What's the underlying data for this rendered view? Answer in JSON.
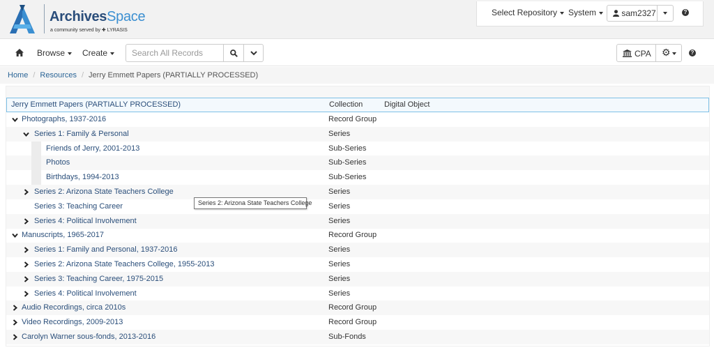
{
  "brand": {
    "name_part1": "Archives",
    "name_part2": "Space",
    "tagline": "a community served by ✚ LYRASIS"
  },
  "header_nav": {
    "select_repository": "Select Repository",
    "system": "System",
    "username": "sam2327"
  },
  "toolbar": {
    "browse": "Browse",
    "create": "Create",
    "search_placeholder": "Search All Records",
    "repo_code": "CPA"
  },
  "breadcrumb": {
    "home": "Home",
    "resources": "Resources",
    "current": "Jerry Emmett Papers (PARTIALLY PROCESSED)"
  },
  "tree": {
    "root": {
      "title": "Jerry Emmett Papers (PARTIALLY PROCESSED)",
      "level_header": "Collection",
      "digital_object_header": "Digital Object"
    },
    "rows": [
      {
        "title": "Photographs, 1937-2016",
        "level": "Record Group",
        "state": "expanded",
        "depth": 0
      },
      {
        "title": "Series 1: Family & Personal",
        "level": "Series",
        "state": "expanded",
        "depth": 1
      },
      {
        "title": "Friends of Jerry, 2001-2013",
        "level": "Sub-Series",
        "state": "leaf",
        "depth": 2
      },
      {
        "title": "Photos",
        "level": "Sub-Series",
        "state": "leaf",
        "depth": 2
      },
      {
        "title": "Birthdays, 1994-2013",
        "level": "Sub-Series",
        "state": "leaf",
        "depth": 2
      },
      {
        "title": "Series 2: Arizona State Teachers College",
        "level": "Series",
        "state": "collapsed",
        "depth": 1
      },
      {
        "title": "Series 3: Teaching Career",
        "level": "Series",
        "state": "leaf",
        "depth": 1
      },
      {
        "title": "Series 4: Political Involvement",
        "level": "Series",
        "state": "collapsed",
        "depth": 1
      },
      {
        "title": "Manuscripts, 1965-2017",
        "level": "Record Group",
        "state": "expanded",
        "depth": 0
      },
      {
        "title": "Series 1: Family and Personal, 1937-2016",
        "level": "Series",
        "state": "collapsed",
        "depth": 1
      },
      {
        "title": "Series 2: Arizona State Teachers College, 1955-2013",
        "level": "Series",
        "state": "collapsed",
        "depth": 1
      },
      {
        "title": "Series 3: Teaching Career, 1975-2015",
        "level": "Series",
        "state": "collapsed",
        "depth": 1
      },
      {
        "title": "Series 4: Political Involvement",
        "level": "Series",
        "state": "collapsed",
        "depth": 1
      },
      {
        "title": "Audio Recordings, circa 2010s",
        "level": "Record Group",
        "state": "collapsed",
        "depth": 0
      },
      {
        "title": "Video Recordings, 2009-2013",
        "level": "Record Group",
        "state": "collapsed",
        "depth": 0
      },
      {
        "title": "Carolyn Warner sous-fonds, 2013-2016",
        "level": "Sub-Fonds",
        "state": "collapsed",
        "depth": 0
      }
    ]
  },
  "tooltip": {
    "text": "Series 2: Arizona State Teachers College"
  },
  "colors": {
    "link": "#2a4e7a",
    "brand_light": "#3b8fd1",
    "root_border": "#7ec0e6"
  }
}
